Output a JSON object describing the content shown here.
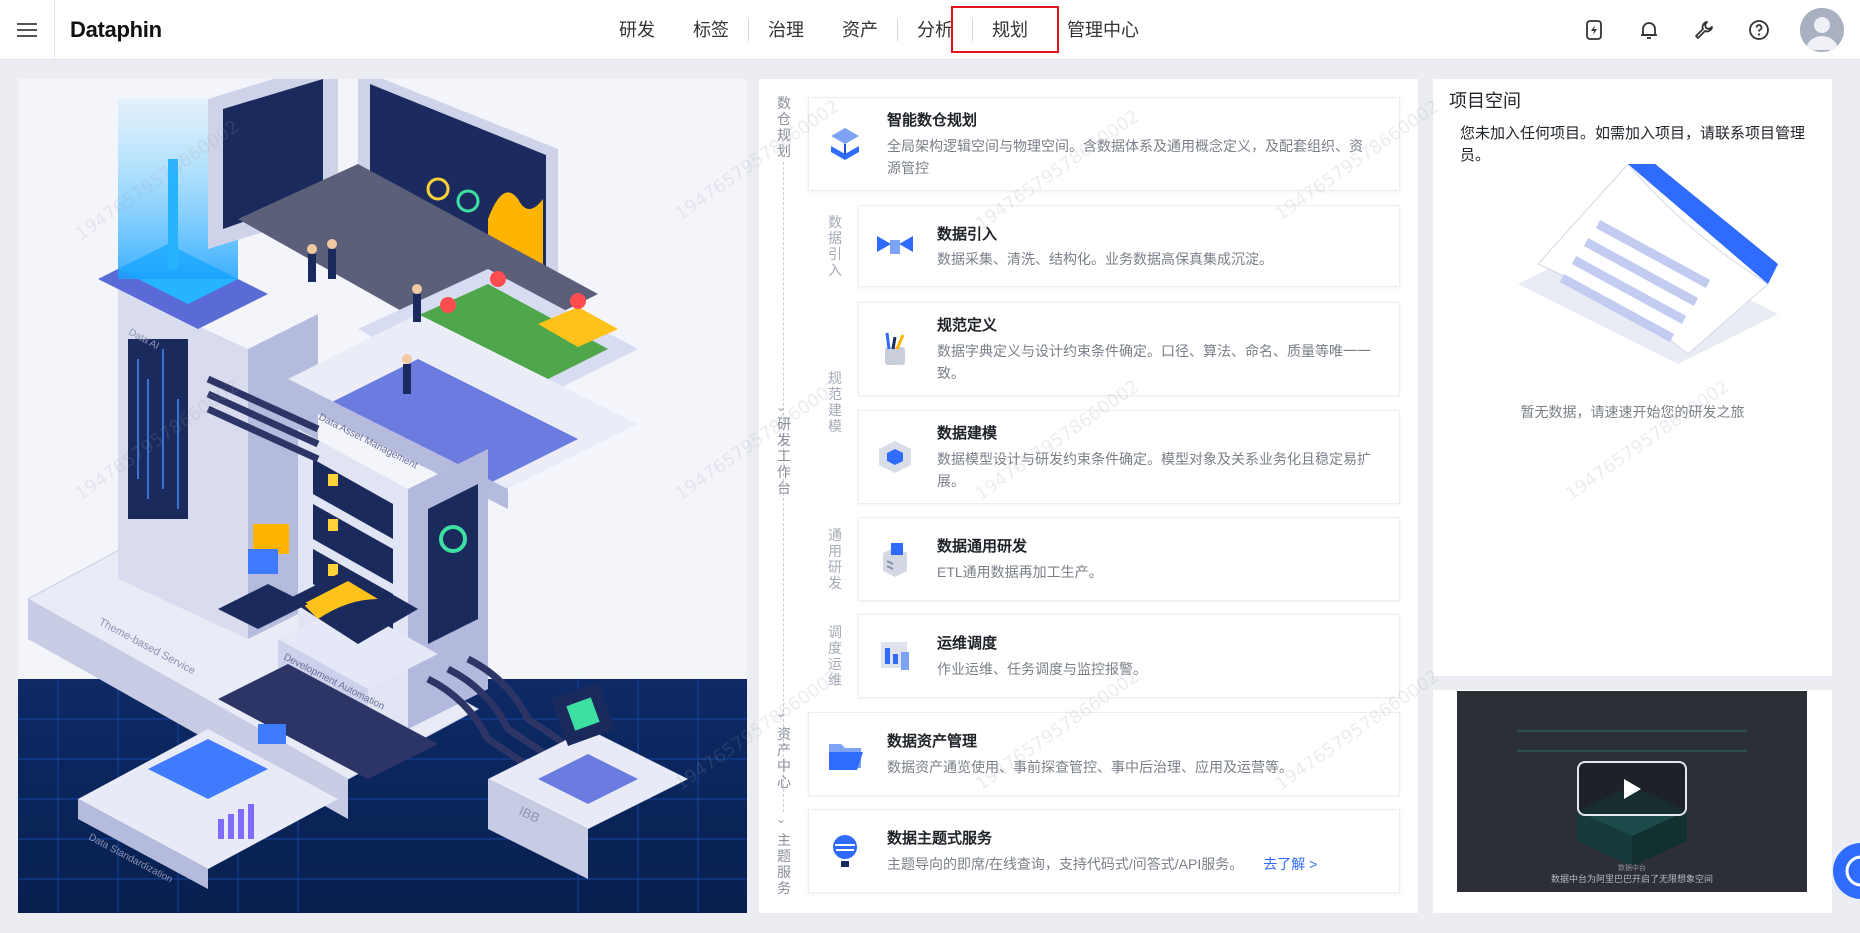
{
  "app": {
    "logo": "Dataphin"
  },
  "nav": {
    "items": [
      "研发",
      "标签",
      "治理",
      "资产",
      "分析",
      "规划",
      "管理中心"
    ],
    "selected": "规划"
  },
  "top_icons": [
    "flash-icon",
    "bell-icon",
    "wrench-icon",
    "help-icon"
  ],
  "stages": {
    "warehouse_planning": "数仓规划",
    "dev_workbench": "研发工作台",
    "asset_center": "资产中心",
    "topic_service": "主题服务",
    "data_import": "数据引入",
    "spec_modeling": "规范建模",
    "general_dev": "通用研发",
    "ops_schedule": "调度运维"
  },
  "cards": {
    "smart_planning": {
      "title": "智能数仓规划",
      "desc": "全局架构逻辑空间与物理空间。含数据体系及通用概念定义，及配套组织、资源管控"
    },
    "data_import": {
      "title": "数据引入",
      "desc": "数据采集、清洗、结构化。业务数据高保真集成沉淀。"
    },
    "spec_define": {
      "title": "规范定义",
      "desc": "数据字典定义与设计约束条件确定。口径、算法、命名、质量等唯一一致。"
    },
    "data_modeling": {
      "title": "数据建模",
      "desc": "数据模型设计与研发约束条件确定。模型对象及关系业务化且稳定易扩展。"
    },
    "general_dev": {
      "title": "数据通用研发",
      "desc": "ETL通用数据再加工生产。"
    },
    "ops": {
      "title": "运维调度",
      "desc": "作业运维、任务调度与监控报警。"
    },
    "asset_mgmt": {
      "title": "数据资产管理",
      "desc": "数据资产通览使用、事前探查管控、事中后治理、应用及运营等。"
    },
    "topic_service": {
      "title": "数据主题式服务",
      "desc": "主题导向的即席/在线查询，支持代码式/问答式/API服务。",
      "link": "去了解 >"
    }
  },
  "project_space": {
    "title": "项目空间",
    "notice": "您未加入任何项目。如需加入项目，请联系项目管理员。",
    "empty": "暂无数据，请速速开始您的研发之旅"
  },
  "video": {
    "caption_small": "数据中台",
    "caption": "数据中台为阿里巴巴开启了无限想象空间"
  },
  "hero_labels": {
    "data_ai": "Data AI",
    "data_asset_mgmt": "Data Asset Management",
    "theme_service": "Theme-based Service",
    "dev_automation": "Development Automation",
    "data_standardization": "Data Standardization",
    "ibb": "IBB"
  },
  "watermark": "19476579578660002",
  "colors": {
    "accent": "#2f6bff",
    "highlight_box": "#e0121c",
    "page_bg": "#ebedf2"
  }
}
